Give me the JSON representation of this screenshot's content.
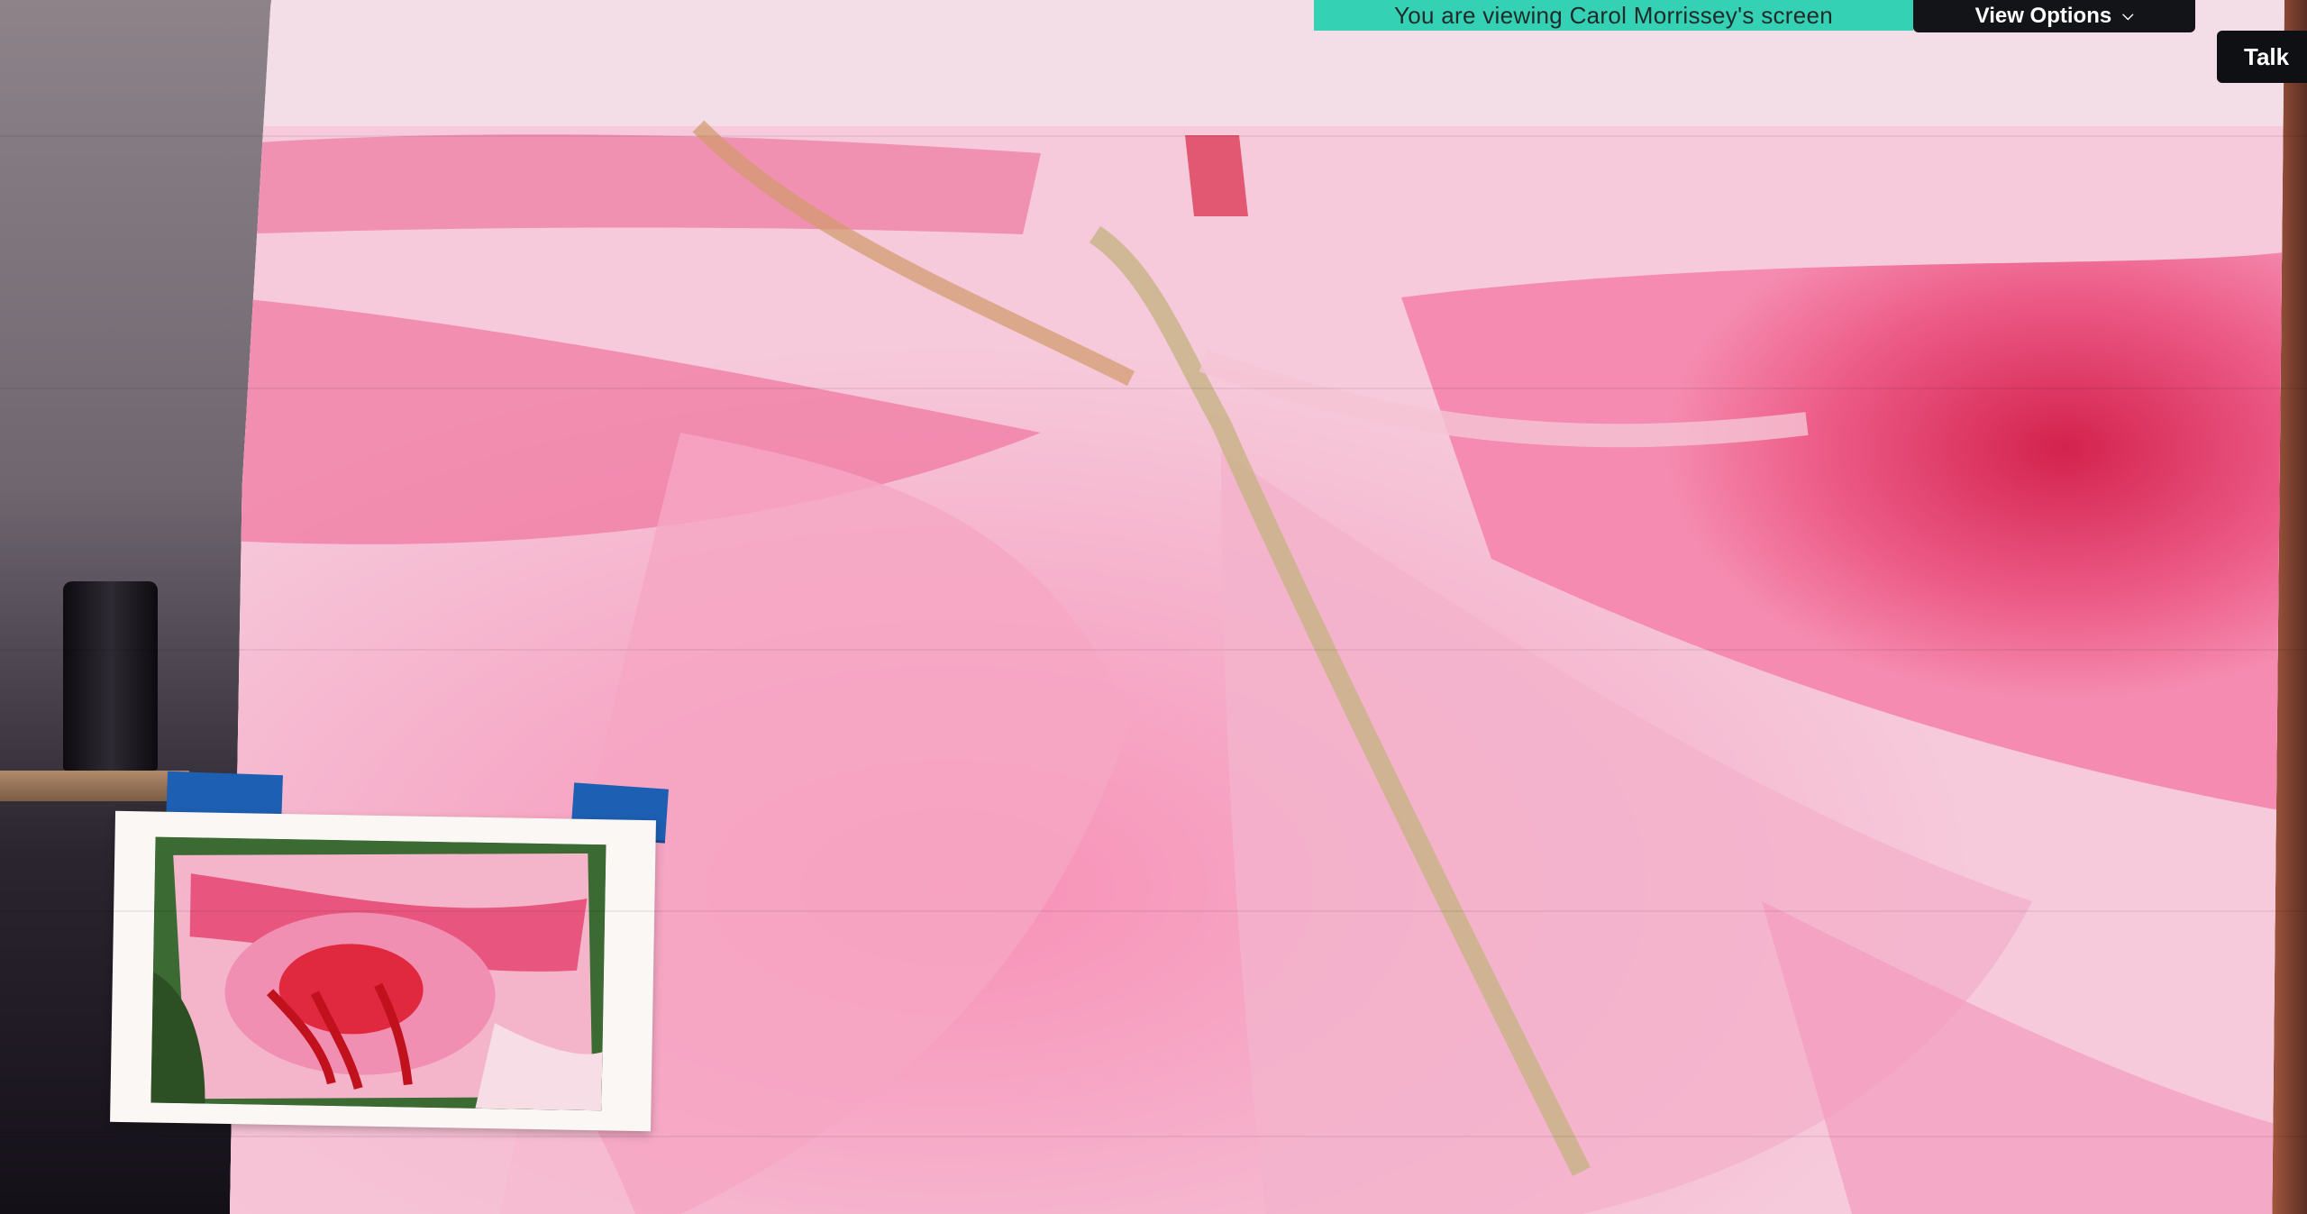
{
  "meeting": {
    "share_banner_text": "You are viewing Carol Morrissey's screen",
    "view_options_label": "View Options",
    "view_options_icon": "chevron-down-icon",
    "talking_label": "Talk"
  },
  "colors": {
    "banner": "#35d1b4",
    "toolbar": "#131418",
    "painting_pink": "#f0699a",
    "painting_deep": "#d8234f",
    "tape_blue": "#1d5fb3"
  }
}
